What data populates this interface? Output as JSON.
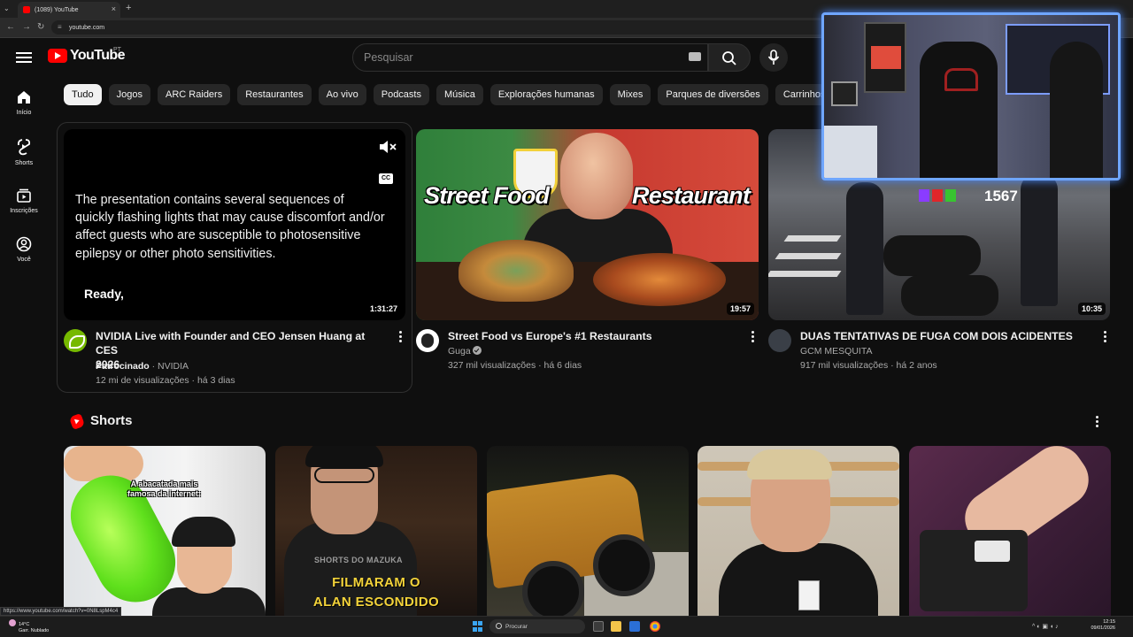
{
  "browser": {
    "tab_title": "(1089) YouTube",
    "url": "youtube.com",
    "new_tab": "+",
    "tab_close": "×"
  },
  "header": {
    "logo_text": "YouTube",
    "country_code": "PT",
    "search_placeholder": "Pesquisar"
  },
  "sidebar": [
    {
      "label": "Início",
      "icon": "home-icon"
    },
    {
      "label": "Shorts",
      "icon": "shorts-icon"
    },
    {
      "label": "Inscrições",
      "icon": "subscriptions-icon"
    },
    {
      "label": "Você",
      "icon": "user-icon"
    }
  ],
  "chips": [
    "Tudo",
    "Jogos",
    "ARC Raiders",
    "Restaurantes",
    "Ao vivo",
    "Podcasts",
    "Música",
    "Explorações humanas",
    "Mixes",
    "Parques de diversões",
    "Carrinhos de"
  ],
  "videos": [
    {
      "title_line1": "NVIDIA Live with Founder and CEO Jensen Huang at CES",
      "title_line2": "2026",
      "sponsored": "Patrocinado",
      "channel": "NVIDIA",
      "meta": "12 mi de visualizações · há 3 dias",
      "duration": "1:31:27",
      "overlay_text": "The presentation contains several sequences of quickly flashing lights that may cause discomfort and/or affect guests who are susceptible to photosensitive epilepsy or other photo sensitivities.",
      "overlay_caption": "Ready,",
      "cc_label": "CC"
    },
    {
      "title": "Street Food vs Europe's #1 Restaurants",
      "channel": "Guga",
      "meta": "327 mil visualizações · há 6 dias",
      "duration": "19:57",
      "thumb_left": "Street Food",
      "thumb_right": "Restaurant"
    },
    {
      "title": "DUAS TENTATIVAS DE FUGA COM DOIS ACIDENTES",
      "channel": "GCM MESQUITA",
      "meta": "917 mil visualizações · há 2 anos",
      "duration": "10:35",
      "thumb_count": "1567"
    }
  ],
  "shorts": {
    "title": "Shorts",
    "s1_caption_1": "A abacatada mais",
    "s1_caption_2": "famosa da internet:",
    "s2_tag": "SHORTS DO MAZUKA",
    "s2_caption_1": "FILMARAM O",
    "s2_caption_2": "ALAN ESCONDIDO"
  },
  "status_url": "https://www.youtube.com/watch?v=0N8LspM4c4",
  "taskbar": {
    "weather_temp": "14°C",
    "weather_desc": "Garr. Nublado",
    "search_label": "Procurar",
    "time": "12:15",
    "date": "09/01/2026"
  },
  "colors": {
    "background": "#0f0f0f",
    "brand_red": "#ff0000",
    "chip_bg": "#272727",
    "chip_active_bg": "#f1f1f1",
    "text_secondary": "#aaaaaa",
    "overlay_border": "#6fa6ff"
  }
}
